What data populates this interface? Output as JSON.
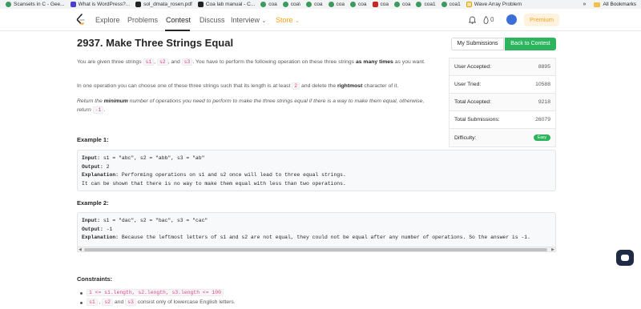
{
  "bookmarks": [
    {
      "label": "Scansets in C - Gee...",
      "icon": "g"
    },
    {
      "label": "What is WordPress?...",
      "icon": "v"
    },
    {
      "label": "sol_dmata_rosen.pdf",
      "icon": "k"
    },
    {
      "label": "Coa lab manual - C...",
      "icon": "k"
    },
    {
      "label": "coa",
      "icon": "g"
    },
    {
      "label": "coa\\",
      "icon": "g"
    },
    {
      "label": "coa",
      "icon": "g"
    },
    {
      "label": "coa",
      "icon": "g"
    },
    {
      "label": "coa",
      "icon": "g"
    },
    {
      "label": "coa",
      "icon": "r"
    },
    {
      "label": "coa",
      "icon": "g"
    },
    {
      "label": "coa1",
      "icon": "g"
    },
    {
      "label": "coa1",
      "icon": "g"
    },
    {
      "label": "Wave Array Problem",
      "icon": "y"
    }
  ],
  "bookmarks_overflow": "»",
  "all_bookmarks": "All Bookmarks",
  "nav": {
    "items": [
      "Explore",
      "Problems",
      "Contest",
      "Discuss",
      "Interview",
      "Store"
    ],
    "active": "Contest",
    "chevron": "⌄",
    "notif_count": "0",
    "premium": "Premium"
  },
  "problem": {
    "title": "2937. Make Three Strings Equal",
    "p1_a": "You are given three strings ",
    "s1": "s1",
    "sep1": ", ",
    "s2": "s2",
    "sep2": ", and ",
    "s3": "s3",
    "p1_b": ". You have to perform the following operation on these three strings ",
    "p1_bold": "as many times",
    "p1_c": " as you want.",
    "p2_a": "In one operation you can choose one of these three strings such that its length is at least ",
    "p2_code": "2",
    "p2_b": " and delete the ",
    "p2_bold": "rightmost",
    "p2_c": " character of it.",
    "p3_a": "Return the ",
    "p3_bold": "minimum",
    "p3_b": " number of operations you need to perform to make the three strings equal if there is a way to make them equal, otherwise, return ",
    "p3_code": "-1",
    "p3_c": "."
  },
  "examples": [
    {
      "title": "Example 1:",
      "input_label": "Input:",
      "input": " s1 = \"abc\", s2 = \"abb\", s3 = \"ab\"",
      "output_label": "Output:",
      "output": " 2",
      "expl_label": "Explanation:",
      "expl": " Performing operations on s1 and s2 once will lead to three equal strings.",
      "expl2": "It can be shown that there is no way to make them equal with less than two operations."
    },
    {
      "title": "Example 2:",
      "input_label": "Input:",
      "input": " s1 = \"dac\", s2 = \"bac\", s3 = \"cac\"",
      "output_label": "Output:",
      "output": " -1",
      "expl_label": "Explanation:",
      "expl": " Because the leftmost letters of s1 and s2 are not equal, they could not be equal after any number of operations. So the answer is -1."
    }
  ],
  "constraints": {
    "title": "Constraints:",
    "c1": "1 <= s1.length, s2.length, s3.length <= 100",
    "c2_s1": "s1",
    "c2_sep": " , ",
    "c2_s2": "s2",
    "c2_and": " and ",
    "c2_s3": "s3",
    "c2_tail": " consist only of lowercase English letters."
  },
  "side": {
    "my_submissions": "My Submissions",
    "back_to_contest": "Back to Contest",
    "stats": [
      {
        "label": "User Accepted:",
        "value": "8895"
      },
      {
        "label": "User Tried:",
        "value": "10588"
      },
      {
        "label": "Total Accepted:",
        "value": "9218"
      },
      {
        "label": "Total Submissions:",
        "value": "26079"
      },
      {
        "label": "Difficulty:",
        "value": "Easy"
      }
    ]
  },
  "colors": {
    "accent": "#ffa116",
    "green": "#2db55d",
    "code_pink": "#e83e8c"
  }
}
